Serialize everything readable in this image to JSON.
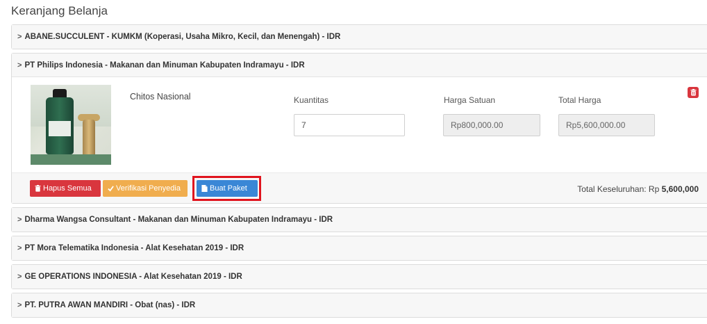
{
  "page": {
    "title": "Keranjang Belanja"
  },
  "vendors": [
    {
      "header": "ABANE.SUCCULENT - KUMKM (Koperasi, Usaha Mikro, Kecil, dan Menengah) - IDR"
    },
    {
      "header": "PT Philips Indonesia - Makanan dan Minuman Kabupaten Indramayu - IDR"
    },
    {
      "header": "Dharma Wangsa Consultant - Makanan dan Minuman Kabupaten Indramayu - IDR"
    },
    {
      "header": "PT Mora Telematika Indonesia - Alat Kesehatan 2019 - IDR"
    },
    {
      "header": "GE OPERATIONS INDONESIA - Alat Kesehatan 2019 - IDR"
    },
    {
      "header": "PT. PUTRA AWAN MANDIRI - Obat (nas) - IDR"
    }
  ],
  "chevron": ">",
  "open_item": {
    "product_name": "Chitos Nasional",
    "quantity_label": "Kuantitas",
    "quantity_value": "7",
    "unit_price_label": "Harga Satuan",
    "unit_price_value": "Rp800,000.00",
    "total_price_label": "Total Harga",
    "total_price_value": "Rp5,600,000.00"
  },
  "footer": {
    "delete_all_label": "Hapus Semua",
    "verify_label": "Verifikasi Penyedia",
    "create_package_label": "Buat Paket",
    "grand_total_label": "Total Keseluruhan: Rp",
    "grand_total_value": "5,600,000"
  },
  "colors": {
    "danger": "#d9363e",
    "warning": "#f0ad4e",
    "primary": "#3a87d6",
    "highlight": "#e0141e"
  },
  "icons": {
    "trash": "trash-icon",
    "check": "check-icon",
    "file": "file-icon"
  }
}
